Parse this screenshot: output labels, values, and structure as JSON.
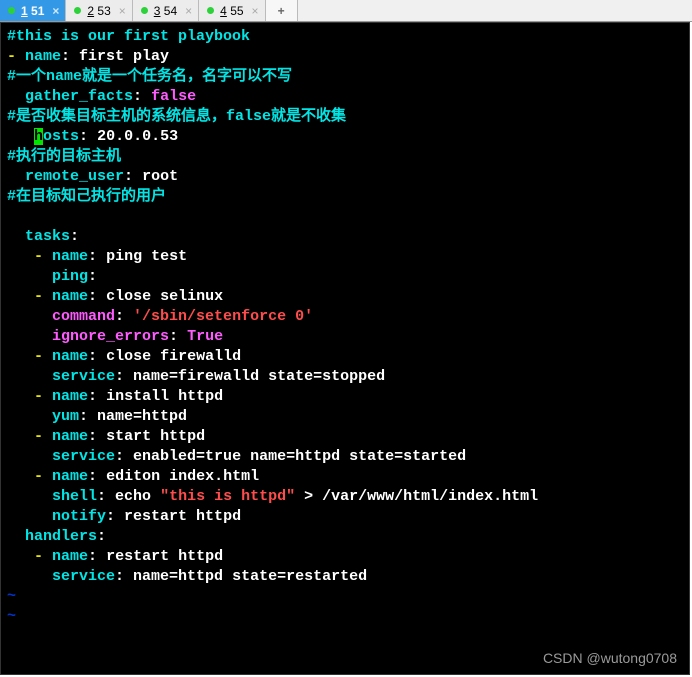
{
  "tabs": [
    {
      "num": "1",
      "rest": " 51",
      "active": true
    },
    {
      "num": "2",
      "rest": " 53",
      "active": false
    },
    {
      "num": "3",
      "rest": " 54",
      "active": false
    },
    {
      "num": "4",
      "rest": " 55",
      "active": false
    }
  ],
  "code": {
    "c01": "#this is our first playbook",
    "c02_dash": "- ",
    "c02_key": "name",
    "c02_colon": ": ",
    "c02_val": "first play",
    "c03": "#一个name就是一个任务名，名字可以不写",
    "c04_key": "gather_facts",
    "c04_colon": ": ",
    "c04_val": "false",
    "c05": "#是否收集目标主机的系统信息，false就是不收集",
    "c06_pre": "   ",
    "c06_cur": "h",
    "c06_key_rest": "osts",
    "c06_colon": ": ",
    "c06_val": "20.0.0.53",
    "c07": "#执行的目标主机",
    "c08_key": "remote_user",
    "c08_colon": ": ",
    "c08_val": "root",
    "c09": "#在目标知己执行的用户",
    "c10_key": "tasks",
    "c10_colon": ":",
    "t1_name": "ping test",
    "t1_ping": "ping",
    "t2_name": "close selinux",
    "t2_cmd_key": "command",
    "t2_cmd_val": "'/sbin/setenforce 0'",
    "t2_ign_key": "ignore_errors",
    "t2_ign_val": "True",
    "t3_name": "close firewalld",
    "t3_svc": "name=firewalld state=stopped",
    "t4_name": "install httpd",
    "t4_yum": "name=httpd",
    "t5_name": "start httpd",
    "t5_svc": "enabled=true name=httpd state=started",
    "t6_name": "editon index.html",
    "t6_shell_pre": "echo ",
    "t6_shell_str": "\"this is httpd\"",
    "t6_shell_post": " > /var/www/html/index.html",
    "t6_notify": "restart httpd",
    "h_key": "handlers",
    "h1_name": "restart httpd",
    "h1_svc": "name=httpd state=restarted",
    "k_name": "name",
    "k_service": "service",
    "k_yum": "yum",
    "k_shell": "shell",
    "k_notify": "notify",
    "dash": "- ",
    "colon_sp": ": ",
    "colon": ":",
    "tilde": "~"
  },
  "watermark": "CSDN @wutong0708"
}
